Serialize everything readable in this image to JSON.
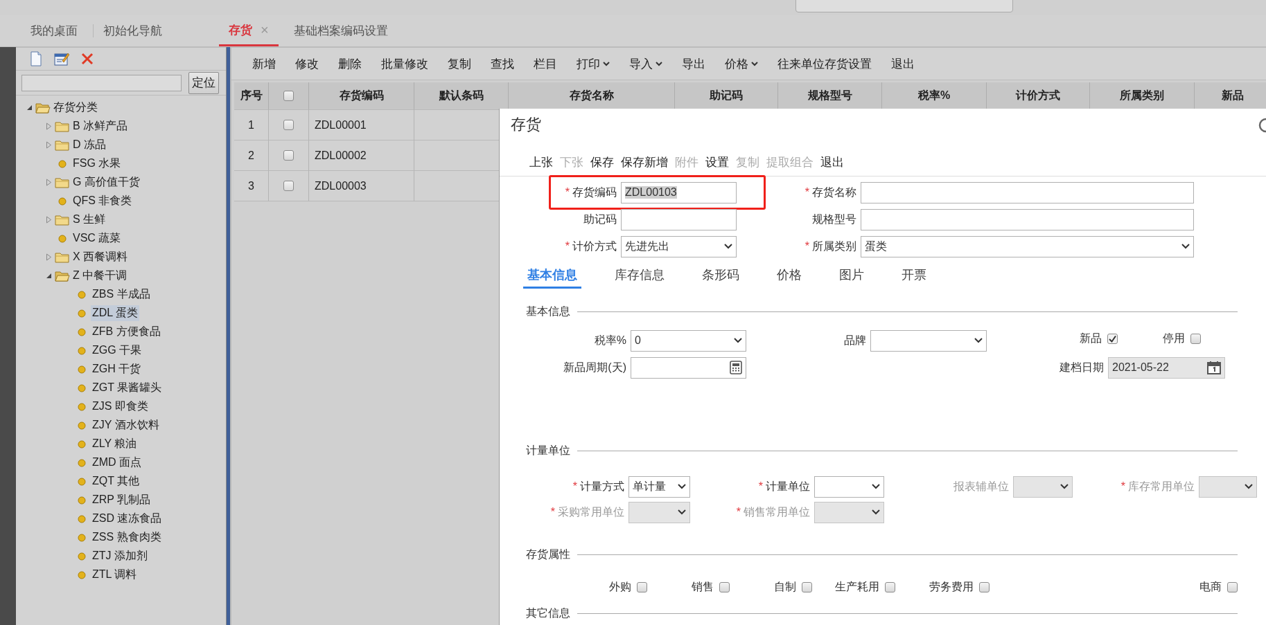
{
  "tabs": [
    {
      "label": "我的桌面",
      "selected": false
    },
    {
      "label": "初始化导航",
      "selected": false
    },
    {
      "label": "存货",
      "selected": true,
      "close": "×"
    },
    {
      "label": "基础档案编码设置",
      "selected": false
    }
  ],
  "sidebar": {
    "locate_button": "定位",
    "tree": [
      {
        "label": "存货分类",
        "kind": "folder",
        "expanded": true,
        "selected": false,
        "children": [
          {
            "label": "B 冰鲜产品",
            "kind": "folder",
            "expanded": false,
            "selected": false
          },
          {
            "label": "D 冻品",
            "kind": "folder",
            "expanded": false,
            "selected": false
          },
          {
            "label": "FSG 水果",
            "kind": "leaf",
            "selected": false
          },
          {
            "label": "G 高价值干货",
            "kind": "folder",
            "expanded": false,
            "selected": false
          },
          {
            "label": "QFS 非食类",
            "kind": "leaf",
            "selected": false
          },
          {
            "label": "S 生鲜",
            "kind": "folder",
            "expanded": false,
            "selected": false
          },
          {
            "label": "VSC 蔬菜",
            "kind": "leaf",
            "selected": false
          },
          {
            "label": "X 西餐调料",
            "kind": "folder",
            "expanded": false,
            "selected": false
          },
          {
            "label": "Z 中餐干调",
            "kind": "folder",
            "expanded": true,
            "selected": false,
            "children": [
              {
                "label": "ZBS 半成品",
                "kind": "leaf",
                "selected": false
              },
              {
                "label": "ZDL 蛋类",
                "kind": "leaf",
                "selected": true
              },
              {
                "label": "ZFB 方便食品",
                "kind": "leaf",
                "selected": false
              },
              {
                "label": "ZGG 干果",
                "kind": "leaf",
                "selected": false
              },
              {
                "label": "ZGH 干货",
                "kind": "leaf",
                "selected": false
              },
              {
                "label": "ZGT 果酱罐头",
                "kind": "leaf",
                "selected": false
              },
              {
                "label": "ZJS 即食类",
                "kind": "leaf",
                "selected": false
              },
              {
                "label": "ZJY 酒水饮料",
                "kind": "leaf",
                "selected": false
              },
              {
                "label": "ZLY 粮油",
                "kind": "leaf",
                "selected": false
              },
              {
                "label": "ZMD 面点",
                "kind": "leaf",
                "selected": false
              },
              {
                "label": "ZQT 其他",
                "kind": "leaf",
                "selected": false
              },
              {
                "label": "ZRP 乳制品",
                "kind": "leaf",
                "selected": false
              },
              {
                "label": "ZSD 速冻食品",
                "kind": "leaf",
                "selected": false
              },
              {
                "label": "ZSS 熟食肉类",
                "kind": "leaf",
                "selected": false
              },
              {
                "label": "ZTJ 添加剂",
                "kind": "leaf",
                "selected": false
              },
              {
                "label": "ZTL 调料",
                "kind": "leaf",
                "selected": false
              }
            ]
          }
        ]
      }
    ]
  },
  "toolbar": [
    {
      "label": "新增",
      "dropdown": false
    },
    {
      "label": "修改",
      "dropdown": false
    },
    {
      "label": "删除",
      "dropdown": false
    },
    {
      "label": "批量修改",
      "dropdown": false
    },
    {
      "label": "复制",
      "dropdown": false
    },
    {
      "label": "查找",
      "dropdown": false
    },
    {
      "label": "栏目",
      "dropdown": false
    },
    {
      "label": "打印",
      "dropdown": true
    },
    {
      "label": "导入",
      "dropdown": true
    },
    {
      "label": "导出",
      "dropdown": false
    },
    {
      "label": "价格",
      "dropdown": true
    },
    {
      "label": "往来单位存货设置",
      "dropdown": false
    },
    {
      "label": "退出",
      "dropdown": false
    }
  ],
  "table": {
    "columns": [
      {
        "kind": "text",
        "label": "序号"
      },
      {
        "kind": "checkbox",
        "checked": false
      },
      {
        "kind": "text",
        "label": "存货编码"
      },
      {
        "kind": "text",
        "label": "默认条码"
      },
      {
        "kind": "text",
        "label": "存货名称"
      },
      {
        "kind": "text",
        "label": "助记码"
      },
      {
        "kind": "text",
        "label": "规格型号"
      },
      {
        "kind": "text",
        "label": "税率%"
      },
      {
        "kind": "text",
        "label": "计价方式"
      },
      {
        "kind": "text",
        "label": "所属类别"
      },
      {
        "kind": "text",
        "label": "新品"
      }
    ],
    "rows": [
      {
        "number": "1",
        "checked": false,
        "code": "ZDL00001"
      },
      {
        "number": "2",
        "checked": false,
        "code": "ZDL00002"
      },
      {
        "number": "3",
        "checked": false,
        "code": "ZDL00003"
      }
    ]
  },
  "dialog": {
    "title": "存货",
    "toolbar": [
      {
        "label": "上张",
        "disabled": false
      },
      {
        "label": "下张",
        "disabled": true
      },
      {
        "label": "保存",
        "disabled": false
      },
      {
        "label": "保存新增",
        "disabled": false
      },
      {
        "label": "附件",
        "disabled": true
      },
      {
        "label": "设置",
        "disabled": false
      },
      {
        "label": "复制",
        "disabled": true
      },
      {
        "label": "提取组合",
        "disabled": true
      },
      {
        "label": "退出",
        "disabled": false
      }
    ],
    "header_fields": [
      {
        "label": "存货编码",
        "required": true,
        "kind": "input",
        "value": "ZDL00103",
        "highlighted": true
      },
      {
        "label": "存货名称",
        "required": true,
        "kind": "input",
        "highlighted": false
      },
      {
        "label": "助记码",
        "required": false,
        "kind": "input",
        "highlighted": false
      },
      {
        "label": "规格型号",
        "required": false,
        "kind": "input",
        "highlighted": false
      },
      {
        "label": "计价方式",
        "required": true,
        "kind": "select",
        "value": "先进先出",
        "highlighted": false
      },
      {
        "label": "所属类别",
        "required": true,
        "kind": "select",
        "value": "蛋类",
        "highlighted": false
      }
    ],
    "tabs": [
      {
        "label": "基本信息",
        "selected": true
      },
      {
        "label": "库存信息",
        "selected": false
      },
      {
        "label": "条形码",
        "selected": false
      },
      {
        "label": "价格",
        "selected": false
      },
      {
        "label": "图片",
        "selected": false
      },
      {
        "label": "开票",
        "selected": false
      }
    ],
    "required_mark": "*",
    "sections": [
      {
        "title": "基本信息",
        "kind": "basic",
        "fields": [
          {
            "kind": "select",
            "label": "税率%",
            "value": "0",
            "required": false,
            "disabled": false
          },
          {
            "kind": "select",
            "label": "品牌",
            "required": false,
            "disabled": false
          },
          {
            "kind": "checkbox",
            "label": "新品",
            "checked": true
          },
          {
            "kind": "checkbox",
            "label": "停用",
            "checked": false
          },
          {
            "kind": "calc",
            "label": "新品周期(天)",
            "required": false,
            "disabled": false
          },
          {
            "kind": "date",
            "label": "建档日期",
            "value": "2021-05-22",
            "required": false,
            "disabled": false,
            "readonly": true
          }
        ]
      },
      {
        "title": "计量单位",
        "kind": "units",
        "fields": [
          {
            "kind": "select",
            "label": "计量方式",
            "value": "单计量",
            "required": true,
            "disabled": false
          },
          {
            "kind": "select",
            "label": "计量单位",
            "required": true,
            "disabled": false
          },
          {
            "kind": "select",
            "label": "报表辅单位",
            "required": false,
            "disabled": true
          },
          {
            "kind": "select",
            "label": "库存常用单位",
            "required": true,
            "disabled": true
          },
          {
            "kind": "select",
            "label": "采购常用单位",
            "required": true,
            "disabled": true
          },
          {
            "kind": "select",
            "label": "销售常用单位",
            "required": true,
            "disabled": true
          }
        ]
      },
      {
        "title": "存货属性",
        "kind": "attributes",
        "fields": [
          {
            "kind": "checkbox",
            "label": "外购",
            "checked": false
          },
          {
            "kind": "checkbox",
            "label": "销售",
            "checked": false
          },
          {
            "kind": "checkbox",
            "label": "自制",
            "checked": false
          },
          {
            "kind": "checkbox",
            "label": "生产耗用",
            "checked": false
          },
          {
            "kind": "checkbox",
            "label": "劳务费用",
            "checked": false
          },
          {
            "kind": "checkbox",
            "label": "电商",
            "checked": false
          }
        ]
      },
      {
        "title": "其它信息",
        "kind": "other"
      }
    ]
  }
}
